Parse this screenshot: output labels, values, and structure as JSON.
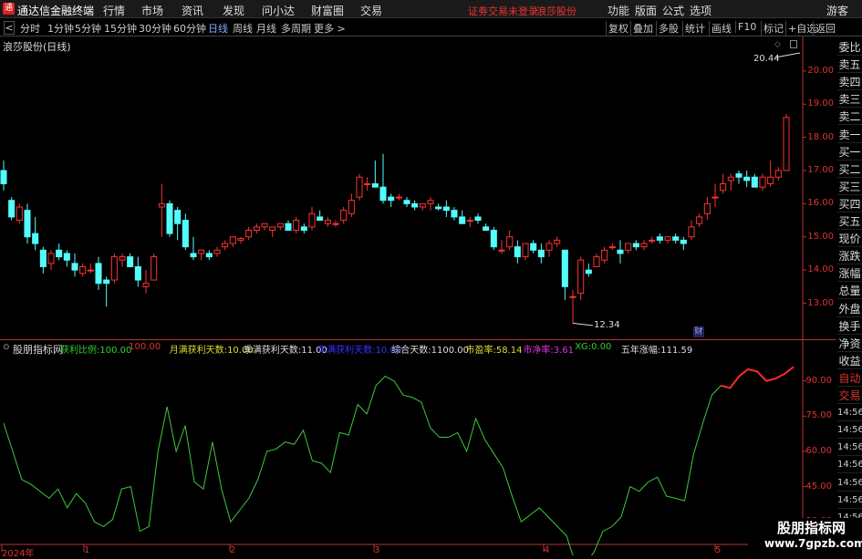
{
  "topbar": {
    "logo": "通",
    "app_title": "通达信金融终端",
    "menus": [
      "行情",
      "市场",
      "资讯",
      "发现",
      "问小达",
      "财富圈",
      "交易"
    ],
    "status_alert": "证劵交易未登录",
    "stock_name": "浪莎股份",
    "right_menus": [
      "功能",
      "版面",
      "公式",
      "选项"
    ],
    "guest": "游客"
  },
  "toolbar": {
    "back": "<",
    "timeframes": [
      "分时",
      "1分钟",
      "5分钟",
      "15分钟",
      "30分钟",
      "60分钟",
      "日线",
      "周线",
      "月线",
      "多周期",
      "更多 >"
    ],
    "active_timeframe": "日线",
    "buttons": [
      "复权",
      "叠加",
      "多股",
      "统计",
      "画线",
      "F10",
      "标记",
      "+自选",
      "返回"
    ]
  },
  "main_chart": {
    "title": "浪莎股份(日线)",
    "high_label": "20.44",
    "low_label": "12.34",
    "cai_badge": "财",
    "y_ticks": [
      "20.00",
      "19.00",
      "18.00",
      "17.00",
      "16.00",
      "15.00",
      "14.00",
      "13.00"
    ]
  },
  "side_panel": {
    "items": [
      "委比",
      "卖五",
      "卖四",
      "卖三",
      "卖二",
      "卖一",
      "买一",
      "买二",
      "买三",
      "买四",
      "买五",
      "现价",
      "涨跌",
      "涨幅",
      "总量",
      "外盘",
      "换手",
      "净资",
      "收益",
      "自动",
      "交易",
      "14:56",
      "14:56",
      "14:56",
      "14:56",
      "14:56",
      "14:56",
      "14:56",
      "14:56"
    ]
  },
  "indicator": {
    "name": "股朋指标网",
    "fields": [
      {
        "label": "获利比例:",
        "value": "100.00",
        "color": "#3c3"
      },
      {
        "label": "",
        "value": "100.00",
        "color": "#d33"
      },
      {
        "label": "月满获利天数:",
        "value": "10.00",
        "color": "#dd3"
      },
      {
        "label": "季满获利天数:",
        "value": "11.00",
        "color": "#ddd"
      },
      {
        "label": "年满获利天数:",
        "value": "10.00",
        "color": "#33f"
      },
      {
        "label": "综合天数:",
        "value": "1100.00",
        "color": "#ddd"
      },
      {
        "label": "市盈率:",
        "value": "58.14",
        "color": "#dd3"
      },
      {
        "label": "市净率:",
        "value": "3.61",
        "color": "#d3d"
      },
      {
        "label": "XG:",
        "value": "0.00",
        "color": "#3c3"
      },
      {
        "label": "五年涨幅:",
        "value": "111.59",
        "color": "#ddd"
      }
    ],
    "y_ticks": [
      "90.00",
      "75.00",
      "60.00",
      "45.00",
      "30.00"
    ]
  },
  "xaxis": {
    "labels": [
      "2024年",
      "1",
      "2",
      "3",
      "4",
      "5"
    ]
  },
  "watermark": {
    "line1": "股朋指标网",
    "line2": "www.7gpzb.com"
  },
  "chart_data": {
    "type": "candlestick",
    "ylim": [
      12.3,
      20.6
    ],
    "candles": [
      [
        17.0,
        17.3,
        16.4,
        16.6
      ],
      [
        16.1,
        16.2,
        15.5,
        15.6
      ],
      [
        15.5,
        16.0,
        15.4,
        15.9
      ],
      [
        15.8,
        16.0,
        14.8,
        15.0
      ],
      [
        15.1,
        15.6,
        14.6,
        14.8
      ],
      [
        14.6,
        14.7,
        13.9,
        14.1
      ],
      [
        14.2,
        14.6,
        14.0,
        14.5
      ],
      [
        14.6,
        14.8,
        14.3,
        14.4
      ],
      [
        14.5,
        14.6,
        14.1,
        14.3
      ],
      [
        14.2,
        14.5,
        13.8,
        14.0
      ],
      [
        13.9,
        14.2,
        13.8,
        14.1
      ],
      [
        14.0,
        14.2,
        13.9,
        14.0
      ],
      [
        14.2,
        14.4,
        13.4,
        13.6
      ],
      [
        13.7,
        13.8,
        12.9,
        13.6
      ],
      [
        13.7,
        14.5,
        13.6,
        14.4
      ],
      [
        14.3,
        14.5,
        14.1,
        14.4
      ],
      [
        14.4,
        14.5,
        14.1,
        14.1
      ],
      [
        14.1,
        14.4,
        13.5,
        13.7
      ],
      [
        13.5,
        14.0,
        13.3,
        13.6
      ],
      [
        13.7,
        14.5,
        13.7,
        14.4
      ],
      [
        15.9,
        16.6,
        15.0,
        16.0
      ],
      [
        16.0,
        16.1,
        15.0,
        15.1
      ],
      [
        15.8,
        15.9,
        14.9,
        15.4
      ],
      [
        15.5,
        15.7,
        14.6,
        14.7
      ],
      [
        14.5,
        15.0,
        14.3,
        14.4
      ],
      [
        14.5,
        14.6,
        14.3,
        14.6
      ],
      [
        14.5,
        14.6,
        14.3,
        14.4
      ],
      [
        14.5,
        14.7,
        14.4,
        14.6
      ],
      [
        14.7,
        14.9,
        14.6,
        14.8
      ],
      [
        14.8,
        15.0,
        14.7,
        15.0
      ],
      [
        14.9,
        15.0,
        14.8,
        14.95
      ],
      [
        15.0,
        15.3,
        14.9,
        15.2
      ],
      [
        15.2,
        15.4,
        15.1,
        15.3
      ],
      [
        15.3,
        15.4,
        15.2,
        15.4
      ],
      [
        15.2,
        15.3,
        15.0,
        15.3
      ],
      [
        15.3,
        15.4,
        15.2,
        15.4
      ],
      [
        15.4,
        15.5,
        15.2,
        15.2
      ],
      [
        15.2,
        15.6,
        15.1,
        15.5
      ],
      [
        15.3,
        15.4,
        15.1,
        15.2
      ],
      [
        15.3,
        15.9,
        15.2,
        15.7
      ],
      [
        15.6,
        15.8,
        15.5,
        15.5
      ],
      [
        15.4,
        15.6,
        15.3,
        15.5
      ],
      [
        15.4,
        15.5,
        15.3,
        15.4
      ],
      [
        15.5,
        15.9,
        15.4,
        15.8
      ],
      [
        15.7,
        16.3,
        15.6,
        16.1
      ],
      [
        16.2,
        16.9,
        16.1,
        16.8
      ],
      [
        16.6,
        16.8,
        16.4,
        16.6
      ],
      [
        16.6,
        17.3,
        16.5,
        16.5
      ],
      [
        16.5,
        17.5,
        16.0,
        16.1
      ],
      [
        16.2,
        16.3,
        15.9,
        16.1
      ],
      [
        16.2,
        16.3,
        16.1,
        16.2
      ],
      [
        16.1,
        16.2,
        15.9,
        16.0
      ],
      [
        16.0,
        16.1,
        15.8,
        15.9
      ],
      [
        15.9,
        16.0,
        15.8,
        16.0
      ],
      [
        16.0,
        16.2,
        15.8,
        16.1
      ],
      [
        15.9,
        16.0,
        15.8,
        15.85
      ],
      [
        15.9,
        16.1,
        15.6,
        15.8
      ],
      [
        15.8,
        15.9,
        15.5,
        15.6
      ],
      [
        15.6,
        15.8,
        15.4,
        15.4
      ],
      [
        15.5,
        15.6,
        15.3,
        15.5
      ],
      [
        15.6,
        15.7,
        15.4,
        15.5
      ],
      [
        15.3,
        15.4,
        15.2,
        15.2
      ],
      [
        15.2,
        15.3,
        14.6,
        14.7
      ],
      [
        14.6,
        14.9,
        14.5,
        14.6
      ],
      [
        14.7,
        15.2,
        14.6,
        15.0
      ],
      [
        14.7,
        14.9,
        14.2,
        14.4
      ],
      [
        14.4,
        14.8,
        14.3,
        14.8
      ],
      [
        14.8,
        14.9,
        14.5,
        14.6
      ],
      [
        14.6,
        14.8,
        14.2,
        14.4
      ],
      [
        14.6,
        14.9,
        14.4,
        14.8
      ],
      [
        14.8,
        15.0,
        14.7,
        14.9
      ],
      [
        14.6,
        14.6,
        13.1,
        13.5
      ],
      [
        13.2,
        13.4,
        12.4,
        13.2
      ],
      [
        13.3,
        14.4,
        13.1,
        14.3
      ],
      [
        14.0,
        14.2,
        13.8,
        13.9
      ],
      [
        14.1,
        14.5,
        14.1,
        14.4
      ],
      [
        14.3,
        14.7,
        14.2,
        14.6
      ],
      [
        14.7,
        14.8,
        14.6,
        14.7
      ],
      [
        14.6,
        14.9,
        14.2,
        14.5
      ],
      [
        14.6,
        14.8,
        14.5,
        14.8
      ],
      [
        14.8,
        14.9,
        14.6,
        14.7
      ],
      [
        14.7,
        14.9,
        14.6,
        14.8
      ],
      [
        14.9,
        15.0,
        14.8,
        14.9
      ],
      [
        15.0,
        15.1,
        14.8,
        14.9
      ],
      [
        14.9,
        15.0,
        14.8,
        15.0
      ],
      [
        15.0,
        15.1,
        14.8,
        14.9
      ],
      [
        14.9,
        15.0,
        14.6,
        14.8
      ],
      [
        15.0,
        15.5,
        14.9,
        15.3
      ],
      [
        15.4,
        15.7,
        15.3,
        15.6
      ],
      [
        15.7,
        16.2,
        15.5,
        16.0
      ],
      [
        16.2,
        16.6,
        15.9,
        16.2
      ],
      [
        16.4,
        16.9,
        16.3,
        16.6
      ],
      [
        16.7,
        16.9,
        16.4,
        16.8
      ],
      [
        16.9,
        17.0,
        16.6,
        16.8
      ],
      [
        16.8,
        17.0,
        16.5,
        16.7
      ],
      [
        16.8,
        16.9,
        16.5,
        16.5
      ],
      [
        16.5,
        16.9,
        16.4,
        16.8
      ],
      [
        16.6,
        17.3,
        16.5,
        16.8
      ],
      [
        16.8,
        17.1,
        16.7,
        17.0
      ],
      [
        17.0,
        18.7,
        17.0,
        18.6
      ]
    ],
    "indicator_series": {
      "name": "股朋指标网",
      "ylim": [
        20,
        100
      ],
      "values": [
        72,
        60,
        48,
        46,
        43,
        40,
        44,
        36,
        42,
        38,
        30,
        28,
        31,
        44,
        45,
        26,
        28,
        60,
        79,
        60,
        71,
        47,
        44,
        64,
        44,
        30,
        35,
        40,
        48,
        60,
        61,
        64,
        63,
        69,
        56,
        55,
        51,
        68,
        67,
        80,
        76,
        88,
        92,
        90,
        84,
        83,
        81,
        70,
        66,
        66,
        68,
        60,
        74,
        65,
        59,
        53,
        41,
        30,
        33,
        36,
        32,
        28,
        24,
        12,
        12,
        17,
        26,
        28,
        32,
        45,
        43,
        47,
        49,
        41,
        40,
        39,
        59,
        72,
        84,
        88,
        87,
        92,
        95,
        94,
        90,
        91,
        93,
        96
      ],
      "red_from": 79
    }
  }
}
